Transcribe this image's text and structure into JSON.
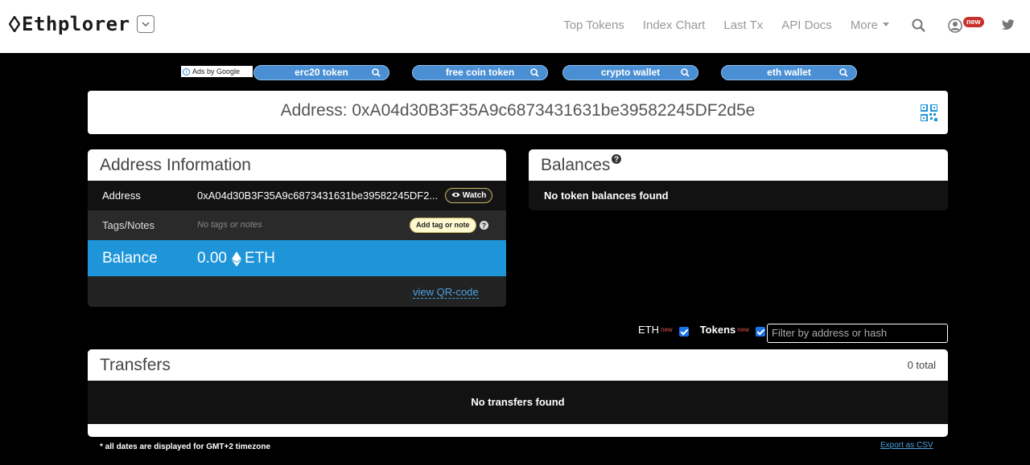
{
  "header": {
    "logo_text": "Ethplorer",
    "nav": [
      "Top Tokens",
      "Index Chart",
      "Last Tx",
      "API Docs",
      "More"
    ],
    "new_badge": "new"
  },
  "ads": {
    "label": "Ads by Google",
    "pills": [
      "erc20 token",
      "free coin token",
      "crypto wallet",
      "eth wallet"
    ]
  },
  "address_bar": {
    "text": "Address: 0xA04d30B3F35A9c6873431631be39582245DF2d5e"
  },
  "address_info": {
    "title": "Address Information",
    "address_label": "Address",
    "address_value": "0xA04d30B3F35A9c6873431631be39582245DF2...",
    "watch_label": "Watch",
    "tags_label": "Tags/Notes",
    "tags_value": "No tags or notes",
    "add_tag_label": "Add tag or note",
    "balance_label": "Balance",
    "balance_value": "0.00",
    "balance_unit": "ETH",
    "qr_link": "view QR-code"
  },
  "balances": {
    "title": "Balances",
    "empty": "No token balances found"
  },
  "filters": {
    "eth_label": "ETH",
    "eth_new": "new",
    "tokens_label": "Tokens",
    "tokens_new": "new",
    "placeholder": "Filter by address or hash"
  },
  "transfers": {
    "title": "Transfers",
    "total": "0 total",
    "empty": "No transfers found"
  },
  "footer": {
    "note": "* all dates are displayed for GMT+2 timezone",
    "export": "Export as CSV"
  }
}
